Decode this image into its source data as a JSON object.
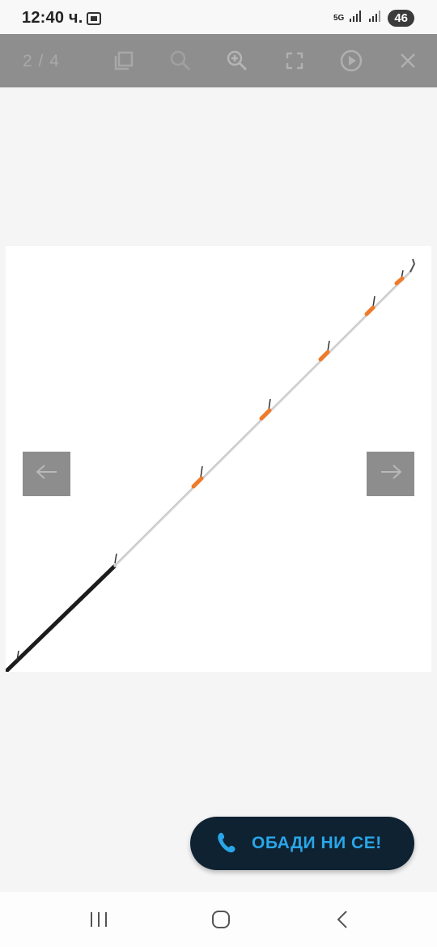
{
  "status_bar": {
    "time": "12:40 ч.",
    "network": "5G",
    "battery": "46",
    "icons": [
      "screenshot-icon",
      "signal-icon",
      "signal-icon",
      "battery-icon"
    ]
  },
  "gallery": {
    "counter": "2 / 4",
    "toolbar_icons": [
      "copy-icon",
      "zoom-out-icon",
      "zoom-in-icon",
      "fullscreen-icon",
      "play-icon",
      "close-icon"
    ],
    "image_description_icon": "fishing-rod-tip-image"
  },
  "navigation": {
    "prev_icon": "arrow-left-icon",
    "next_icon": "arrow-right-icon"
  },
  "call_button": {
    "label": "ОБАДИ НИ СЕ!",
    "icon": "phone-icon",
    "background": "#0f2232",
    "text_color": "#29a6e8"
  },
  "system_nav": {
    "icons": [
      "recents-icon",
      "home-icon",
      "back-icon"
    ]
  }
}
